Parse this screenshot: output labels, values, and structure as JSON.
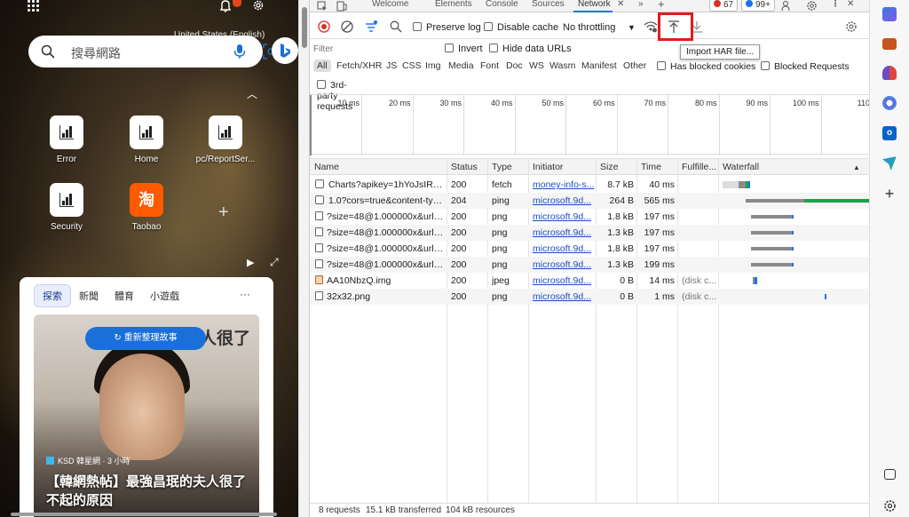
{
  "ntp": {
    "search_placeholder": "搜尋網路",
    "region_text": "United States (English)",
    "tiles": [
      {
        "label": "Error"
      },
      {
        "label": "Home"
      },
      {
        "label": "pc/ReportSer..."
      },
      {
        "label": "Security"
      },
      {
        "label": "Taobao",
        "glyph": "淘"
      }
    ],
    "feed": {
      "tabs": [
        "探索",
        "新聞",
        "體育",
        "小遊戲"
      ],
      "more": "···",
      "refresh_label": "重新整理故事",
      "story_bg_text": "夫人很了",
      "source": "KSD 韓星網 · 3 小時",
      "headline": "【韓網熱帖】最強昌珉的夫人很了不起的原因"
    }
  },
  "devtools": {
    "tabs": [
      "Welcome",
      "Elements",
      "Console",
      "Sources",
      "Network"
    ],
    "active_tab": "Network",
    "more_tabs": "»",
    "add_tab": "+",
    "errors_count": "67",
    "messages_count": "99+",
    "toolbar": {
      "preserve_log": "Preserve log",
      "disable_cache": "Disable cache",
      "throttling": "No throttling",
      "throttle_caret": "▼",
      "import_tooltip": "Import HAR file..."
    },
    "filter_placeholder": "Filter",
    "invert": "Invert",
    "hide_data_urls": "Hide data URLs",
    "types": [
      "All",
      "Fetch/XHR",
      "JS",
      "CSS",
      "Img",
      "Media",
      "Font",
      "Doc",
      "WS",
      "Wasm",
      "Manifest",
      "Other"
    ],
    "has_blocked_cookies": "Has blocked cookies",
    "blocked_requests": "Blocked Requests",
    "third_party": "3rd-party requests",
    "timeline_ticks": [
      "10 ms",
      "20 ms",
      "30 ms",
      "40 ms",
      "50 ms",
      "60 ms",
      "70 ms",
      "80 ms",
      "90 ms",
      "100 ms",
      "110"
    ],
    "columns": [
      "Name",
      "Status",
      "Type",
      "Initiator",
      "Size",
      "Time",
      "Fulfille...",
      "Waterfall"
    ],
    "sort_indicator": "▲",
    "rows": [
      {
        "name": "Charts?apikey=1hYoJsIRvP...",
        "status": "200",
        "type": "fetch",
        "initiator": "money-info-s...",
        "size": "8.7 kB",
        "time": "40 ms",
        "fulfilled": ""
      },
      {
        "name": "1.0?cors=true&content-typ...",
        "status": "204",
        "type": "ping",
        "initiator": "microsoft.9d...",
        "size": "264 B",
        "time": "565 ms",
        "fulfilled": ""
      },
      {
        "name": "?size=48@1.000000x&url=...",
        "status": "200",
        "type": "png",
        "initiator": "microsoft.9d...",
        "size": "1.8 kB",
        "time": "197 ms",
        "fulfilled": ""
      },
      {
        "name": "?size=48@1.000000x&url=...",
        "status": "200",
        "type": "png",
        "initiator": "microsoft.9d...",
        "size": "1.3 kB",
        "time": "197 ms",
        "fulfilled": ""
      },
      {
        "name": "?size=48@1.000000x&url=...",
        "status": "200",
        "type": "png",
        "initiator": "microsoft.9d...",
        "size": "1.8 kB",
        "time": "197 ms",
        "fulfilled": ""
      },
      {
        "name": "?size=48@1.000000x&url=...",
        "status": "200",
        "type": "png",
        "initiator": "microsoft.9d...",
        "size": "1.3 kB",
        "time": "199 ms",
        "fulfilled": ""
      },
      {
        "name": "AA10NbzQ.img",
        "status": "200",
        "type": "jpeg",
        "initiator": "microsoft.9d...",
        "size": "0 B",
        "time": "14 ms",
        "fulfilled": "(disk c..."
      },
      {
        "name": "32x32.png",
        "status": "200",
        "type": "png",
        "initiator": "microsoft.9d...",
        "size": "0 B",
        "time": "1 ms",
        "fulfilled": "(disk c..."
      }
    ],
    "status_requests": "8 requests",
    "status_transferred": "15.1 kB transferred",
    "status_resources": "104 kB resources"
  },
  "colors": {
    "accent": "#1a73e8",
    "highlight": "#e21b1b",
    "waterfall_green": "#1aa34a",
    "waterfall_gray": "#8a8a8a",
    "waterfall_blue": "#1a73e8"
  }
}
